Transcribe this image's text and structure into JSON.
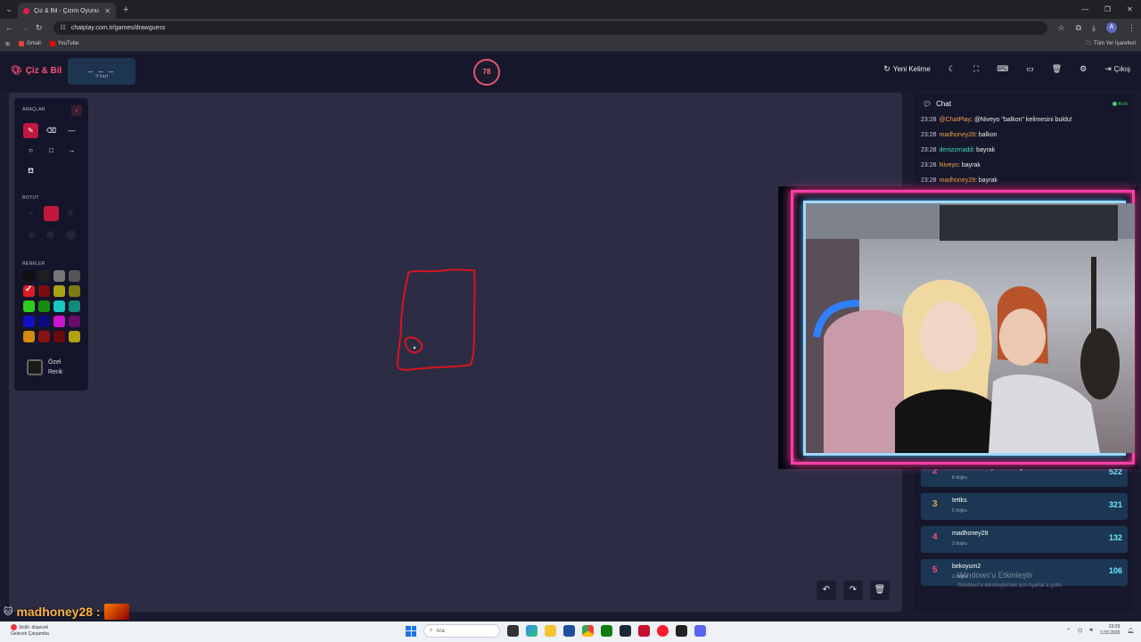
{
  "browser": {
    "tab_title": "Çiz & Bil - Çizim Oyunu",
    "url": "chatplay.com.tr/games/drawguess",
    "bookmarks": [
      "Gmail",
      "YouTube"
    ],
    "all_bookmarks": "Tüm Yer İşaretleri",
    "profile_initial": "A"
  },
  "app": {
    "brand": "Çiz & Bil",
    "word_blanks": "_ _ _",
    "word_hint": "3 harf",
    "timer": "78",
    "actions": {
      "new_word": "Yeni Kelime",
      "logout": "Çıkış"
    }
  },
  "tools": {
    "tools_label": "ARAÇLAR",
    "size_label": "BOYUT",
    "colors_label": "RENKLER",
    "custom_color": "Özel Renk",
    "colors": [
      "#111111",
      "#1e1e1e",
      "#777777",
      "#555555",
      "#e11d24",
      "#7a0d0d",
      "#a8a516",
      "#7f7a12",
      "#2ecc1f",
      "#198a12",
      "#19c9c0",
      "#138a78",
      "#1410c8",
      "#0a0a7a",
      "#cc14cc",
      "#6a0a6a",
      "#d48a0c",
      "#8a1212",
      "#6a0a0a",
      "#b5a010"
    ],
    "selected_color": "#e11d24"
  },
  "chat": {
    "title": "Chat",
    "platform": "Kick",
    "messages": [
      {
        "time": "23:28",
        "user": "@ChatPlay",
        "user_color": "#f0a04b",
        "text": "@Niveyo \"balkon\" kelimesini buldu!"
      },
      {
        "time": "23:28",
        "user": "madhoney28",
        "user_color": "#f0a04b",
        "text": "balkon"
      },
      {
        "time": "23:28",
        "user": "denizzmadd",
        "user_color": "#3fd9c0",
        "text": "bayrak"
      },
      {
        "time": "23:28",
        "user": "Niveyo",
        "user_color": "#f0a04b",
        "text": "bayrak"
      },
      {
        "time": "23:28",
        "user": "madhoney28",
        "user_color": "#f0a04b",
        "text": "bayrak"
      }
    ]
  },
  "leaderboard": [
    {
      "rank": "2",
      "rank_color": "#ff4d7a",
      "name": "kırmızıdudaklıyarasabaligi",
      "correct": "8 doğru",
      "points": "522"
    },
    {
      "rank": "3",
      "rank_color": "#f0a04b",
      "name": "tettks",
      "correct": "5 doğru",
      "points": "321"
    },
    {
      "rank": "4",
      "rank_color": "#ff4d7a",
      "name": "madhoney28",
      "correct": "3 doğru",
      "points": "132"
    },
    {
      "rank": "5",
      "rank_color": "#ff4d7a",
      "name": "bekoyum2",
      "correct": "2 doğru",
      "points": "106"
    }
  ],
  "watermark": {
    "title": "Windows'u Etkinleştir",
    "subtitle": "Windows'u etkinleştirmek için Ayarlar'a gidin."
  },
  "overlay_user": "madhoney28 :",
  "taskbar": {
    "weather_line1": "Sicikl. düşecek",
    "weather_line2": "Gelecek Çarşamba",
    "search_placeholder": "Ara",
    "time": "23:29",
    "date": "1.03.2026"
  }
}
